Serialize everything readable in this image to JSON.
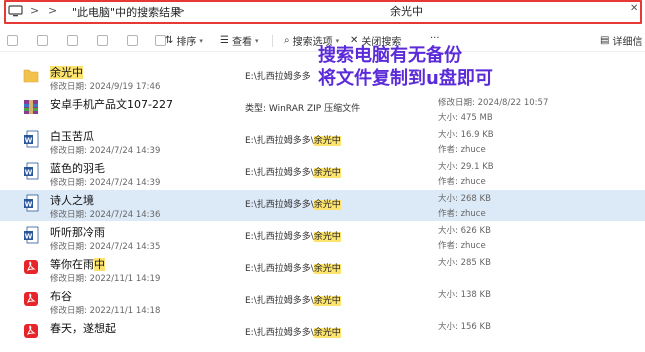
{
  "address_bar": {
    "location": "\"此电脑\"中的搜索结果",
    "search_query": "余光中"
  },
  "toolbar": {
    "sort_label": "排序",
    "view_label": "查看",
    "search_options_label": "搜索选项",
    "close_search_label": "关闭搜索",
    "more_label": "···",
    "details_label": "详细信"
  },
  "annotation": {
    "line1": "搜索电脑有无备份",
    "line2": "将文件复制到u盘即可"
  },
  "colors": {
    "highlight": "#fbe36e",
    "annotation_text": "#5b2bd9",
    "address_border": "#e53935",
    "selected_row": "#dce9f7"
  },
  "files": [
    {
      "icon": "folder-icon",
      "name_pre": "",
      "name_hl": "余光中",
      "name_post": "",
      "date": "修改日期: 2024/9/19 17:46",
      "path_pre": "E:\\扎西拉姆多多",
      "path_hl": "",
      "meta1": "",
      "meta2": ""
    },
    {
      "icon": "zip-archive-icon",
      "name_pre": "安卓手机产品文107-227",
      "name_hl": "",
      "name_post": "",
      "date": "",
      "path_pre": "类型: WinRAR ZIP 压缩文件",
      "path_hl": "",
      "meta1": "修改日期: 2024/8/22 10:57",
      "meta2": "大小: 475 MB"
    },
    {
      "icon": "word-doc-icon",
      "name_pre": "白玉苦瓜",
      "name_hl": "",
      "name_post": "",
      "date": "修改日期: 2024/7/24 14:39",
      "path_pre": "E:\\扎西拉姆多多\\",
      "path_hl": "余光中",
      "meta1": "大小: 16.9 KB",
      "meta2": "作者: zhuce"
    },
    {
      "icon": "word-doc-icon",
      "name_pre": "蓝色的羽毛",
      "name_hl": "",
      "name_post": "",
      "date": "修改日期: 2024/7/24 14:39",
      "path_pre": "E:\\扎西拉姆多多\\",
      "path_hl": "余光中",
      "meta1": "大小: 29.1 KB",
      "meta2": "作者: zhuce"
    },
    {
      "icon": "word-doc-icon",
      "name_pre": "诗人之境",
      "name_hl": "",
      "name_post": "",
      "date": "修改日期: 2024/7/24 14:36",
      "path_pre": "E:\\扎西拉姆多多\\",
      "path_hl": "余光中",
      "meta1": "大小: 268 KB",
      "meta2": "作者: zhuce"
    },
    {
      "icon": "word-doc-icon",
      "name_pre": "听听那冷雨",
      "name_hl": "",
      "name_post": "",
      "date": "修改日期: 2024/7/24 14:35",
      "path_pre": "E:\\扎西拉姆多多\\",
      "path_hl": "余光中",
      "meta1": "大小: 626 KB",
      "meta2": "作者: zhuce"
    },
    {
      "icon": "pdf-icon",
      "name_pre": "等你在雨",
      "name_hl": "中",
      "name_post": "",
      "date": "修改日期: 2022/11/1 14:19",
      "path_pre": "E:\\扎西拉姆多多\\",
      "path_hl": "余光中",
      "meta1": "大小: 285 KB",
      "meta2": ""
    },
    {
      "icon": "pdf-icon",
      "name_pre": "布谷",
      "name_hl": "",
      "name_post": "",
      "date": "修改日期: 2022/11/1 14:18",
      "path_pre": "E:\\扎西拉姆多多\\",
      "path_hl": "余光中",
      "meta1": "大小: 138 KB",
      "meta2": ""
    },
    {
      "icon": "pdf-icon",
      "name_pre": "春天，遂想起",
      "name_hl": "",
      "name_post": "",
      "date": "",
      "path_pre": "E:\\扎西拉姆多多\\",
      "path_hl": "余光中",
      "meta1": "大小: 156 KB",
      "meta2": ""
    }
  ]
}
